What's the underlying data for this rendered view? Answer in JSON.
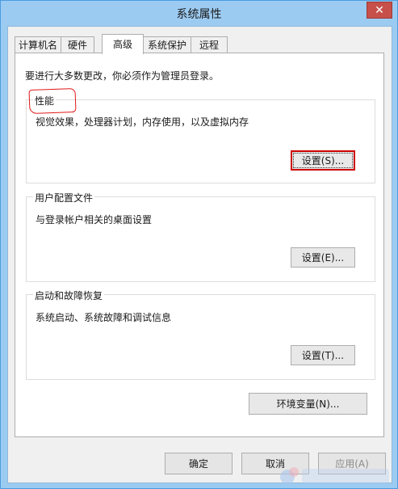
{
  "window": {
    "title": "系统属性",
    "close_glyph": "✕"
  },
  "tabs": [
    {
      "label": "计算机名",
      "active": false
    },
    {
      "label": "硬件",
      "active": false
    },
    {
      "label": "高级",
      "active": true
    },
    {
      "label": "系统保护",
      "active": false
    },
    {
      "label": "远程",
      "active": false
    }
  ],
  "intro": "要进行大多数更改，你必须作为管理员登录。",
  "performance": {
    "title": "性能",
    "description": "视觉效果，处理器计划，内存使用，以及虚拟内存",
    "button": "设置(S)..."
  },
  "user_profiles": {
    "title": "用户配置文件",
    "description": "与登录帐户相关的桌面设置",
    "button": "设置(E)..."
  },
  "startup_recovery": {
    "title": "启动和故障恢复",
    "description": "系统启动、系统故障和调试信息",
    "button": "设置(T)..."
  },
  "env_button": "环境变量(N)...",
  "footer": {
    "ok": "确定",
    "cancel": "取消",
    "apply": "应用(A)"
  },
  "colors": {
    "accent": "#9ccbf2",
    "annotation": "#e01818",
    "close": "#c7504a"
  }
}
